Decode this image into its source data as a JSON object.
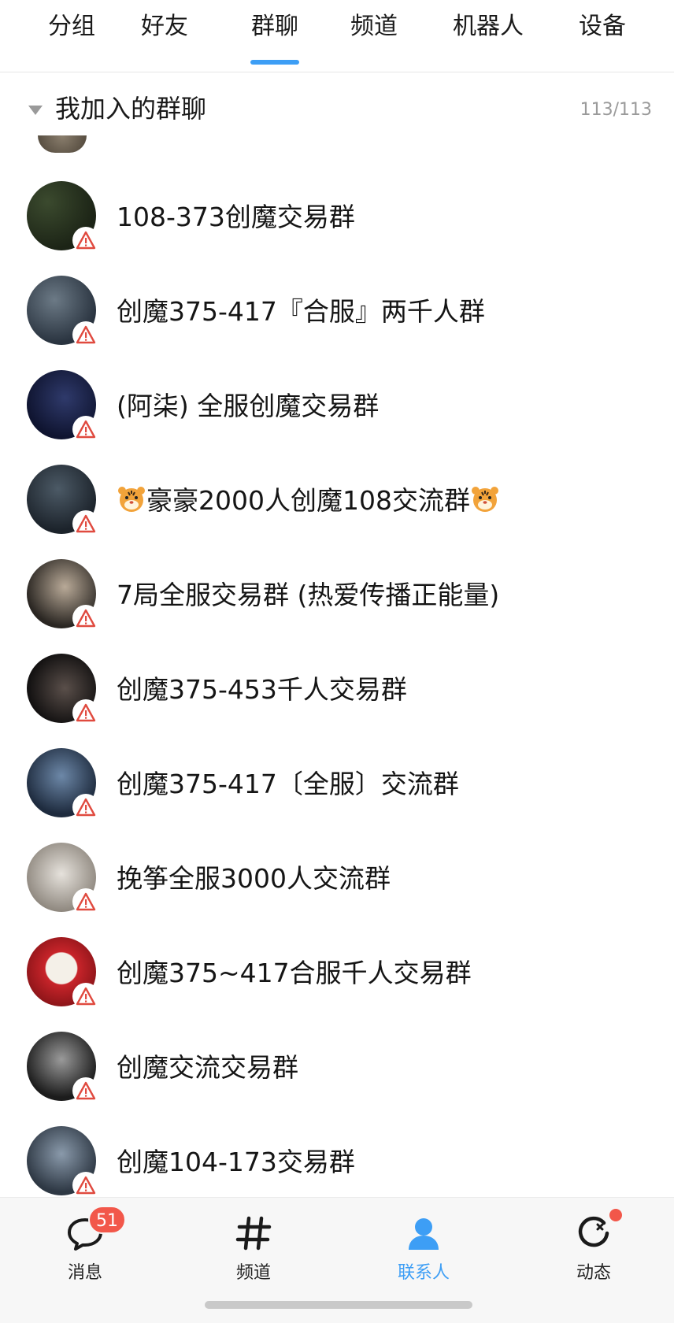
{
  "top_tabs": [
    {
      "label": "分组"
    },
    {
      "label": "好友"
    },
    {
      "label": "群聊",
      "active": true
    },
    {
      "label": "频道"
    },
    {
      "label": "机器人"
    },
    {
      "label": "设备"
    }
  ],
  "section": {
    "title": "我加入的群聊",
    "count": "113/113"
  },
  "groups": [
    {
      "name": "108-373创魔交易群"
    },
    {
      "name": "创魔375-417『合服』两千人群"
    },
    {
      "name": "(阿柒) 全服创魔交易群"
    },
    {
      "name_prefix_icon": "tiger-emoji",
      "name": "豪豪2000人创魔108交流群",
      "name_suffix_icon": "tiger-emoji"
    },
    {
      "name": "7局全服交易群 (热爱传播正能量)"
    },
    {
      "name": "创魔375-453千人交易群"
    },
    {
      "name": "创魔375-417〔全服〕交流群"
    },
    {
      "name": "挽筝全服3000人交流群"
    },
    {
      "name": "创魔375~417合服千人交易群"
    },
    {
      "name": "创魔交流交易群"
    },
    {
      "name": "创魔104-173交易群"
    }
  ],
  "bottom_nav": [
    {
      "label": "消息",
      "icon": "message-bubble-icon",
      "badge": "51"
    },
    {
      "label": "频道",
      "icon": "hash-icon"
    },
    {
      "label": "联系人",
      "icon": "contact-person-icon",
      "active": true
    },
    {
      "label": "动态",
      "icon": "activity-circle-icon",
      "dot": true
    }
  ],
  "colors": {
    "accent": "#3d9ef5",
    "badge": "#f2574a",
    "warning": "#e04a3f"
  }
}
